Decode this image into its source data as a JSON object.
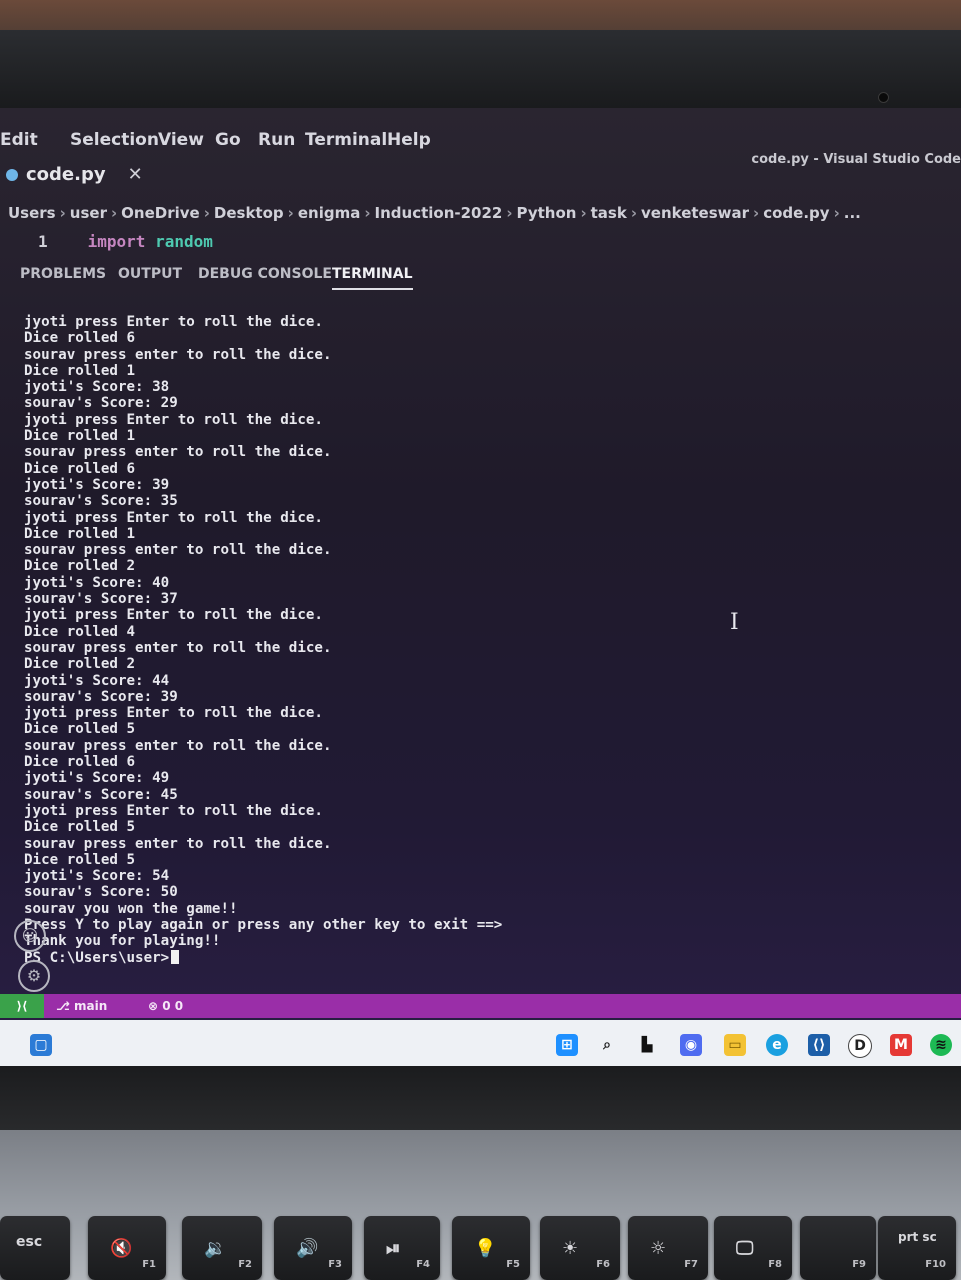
{
  "menu": {
    "items": [
      "Edit",
      "Selection",
      "View",
      "Go",
      "Run",
      "Terminal",
      "Help"
    ],
    "window_title": "code.py - Visual Studio Code"
  },
  "tab": {
    "filename": "code.py",
    "close": "✕"
  },
  "breadcrumb": [
    "Users",
    "user",
    "OneDrive",
    "Desktop",
    "enigma",
    "Induction-2022",
    "Python",
    "task",
    "venketeswar",
    "code.py",
    "..."
  ],
  "editor": {
    "line_number": "1",
    "keyword": "import",
    "module": "random"
  },
  "panel_tabs": [
    "PROBLEMS",
    "OUTPUT",
    "DEBUG CONSOLE",
    "TERMINAL"
  ],
  "terminal": {
    "lines": [
      "jyoti press Enter to roll the dice.",
      "Dice rolled 6",
      "sourav press enter to roll the dice.",
      "Dice rolled 1",
      "jyoti's Score: 38",
      "sourav's Score: 29",
      "jyoti press Enter to roll the dice.",
      "Dice rolled 1",
      "sourav press enter to roll the dice.",
      "Dice rolled 6",
      "jyoti's Score: 39",
      "sourav's Score: 35",
      "jyoti press Enter to roll the dice.",
      "Dice rolled 1",
      "sourav press enter to roll the dice.",
      "Dice rolled 2",
      "jyoti's Score: 40",
      "sourav's Score: 37",
      "jyoti press Enter to roll the dice.",
      "Dice rolled 4",
      "sourav press enter to roll the dice.",
      "Dice rolled 2",
      "jyoti's Score: 44",
      "sourav's Score: 39",
      "jyoti press Enter to roll the dice.",
      "Dice rolled 5",
      "sourav press enter to roll the dice.",
      "Dice rolled 6",
      "jyoti's Score: 49",
      "sourav's Score: 45",
      "jyoti press Enter to roll the dice.",
      "Dice rolled 5",
      "sourav press enter to roll the dice.",
      "Dice rolled 5",
      "jyoti's Score: 54",
      "sourav's Score: 50",
      "sourav you won the game!!",
      "Press Y to play again or press any other key to exit ==>",
      "Thank you for playing!!"
    ],
    "prompt": "PS C:\\Users\\user>"
  },
  "statusbar": {
    "branch": "main",
    "counts": "0 0"
  },
  "keyboard": {
    "keys": [
      {
        "top": "esc",
        "fn": ""
      },
      {
        "top": "🔇",
        "fn": "F1"
      },
      {
        "top": "🔉",
        "fn": "F2"
      },
      {
        "top": "🔊",
        "fn": "F3"
      },
      {
        "top": "⏯",
        "fn": "F4"
      },
      {
        "top": "💡",
        "fn": "F5"
      },
      {
        "top": "☀",
        "fn": "F6"
      },
      {
        "top": "☼",
        "fn": "F7"
      },
      {
        "top": "🖵",
        "fn": "F8"
      },
      {
        "top": "",
        "fn": "F9"
      },
      {
        "top": "prt sc",
        "fn": "F10"
      }
    ]
  }
}
